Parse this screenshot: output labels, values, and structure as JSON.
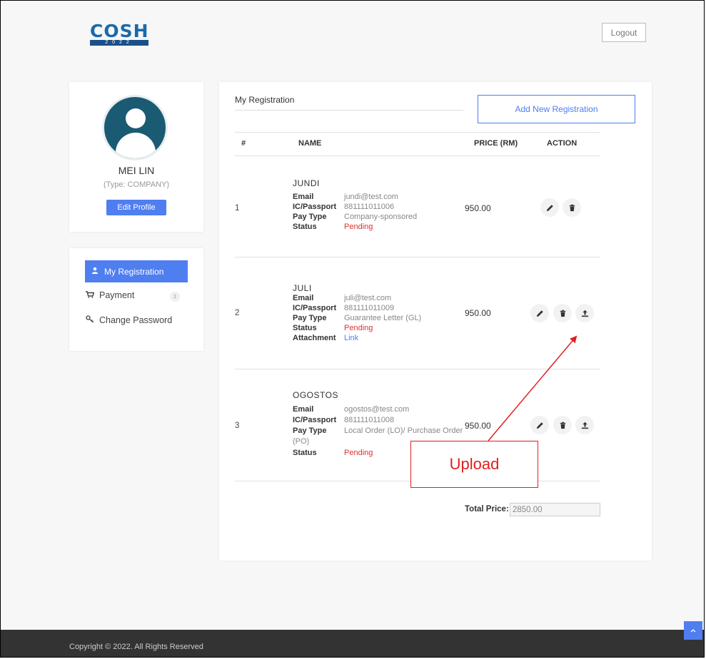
{
  "header": {
    "logo_text": "COSH",
    "logo_sub": "2022",
    "logout_label": "Logout"
  },
  "profile": {
    "name": "MEI LIN",
    "type": "(Type: COMPANY)",
    "edit_label": "Edit Profile"
  },
  "menu": {
    "items": [
      {
        "label": "My Registration",
        "icon": "user-icon"
      },
      {
        "label": "Payment",
        "icon": "cart-icon",
        "badge": "1"
      },
      {
        "label": "Change Password",
        "icon": "key-icon"
      }
    ]
  },
  "main": {
    "title": "My Registration",
    "add_label": "Add New Registration",
    "headers": {
      "num": "#",
      "name": "NAME",
      "price": "PRICE (RM)",
      "action": "ACTION"
    },
    "field_labels": {
      "email": "Email",
      "ic": "IC/Passport",
      "pay_type": "Pay Type",
      "status": "Status",
      "attachment": "Attachment"
    },
    "rows": [
      {
        "num": "1",
        "name": "JUNDI",
        "email": "jundi@test.com",
        "ic": "881111011006",
        "pay_type": "Company-sponsored",
        "status": "Pending",
        "price": "950.00"
      },
      {
        "num": "2",
        "name": "JULI",
        "email": "juli@test.com",
        "ic": "881111011009",
        "pay_type": "Guarantee Letter (GL)",
        "status": "Pending",
        "attachment": "Link",
        "price": "950.00"
      },
      {
        "num": "3",
        "name": "OGOSTOS",
        "email": "ogostos@test.com",
        "ic": "881111011008",
        "pay_type_line1": "Local Order (LO)/ Purchase Order",
        "pay_type_line2": "(PO)",
        "status": "Pending",
        "price": "950.00"
      }
    ],
    "total_label": "Total Price:",
    "total_value": "2850.00"
  },
  "annotation": {
    "label": "Upload",
    "color": "#e02020"
  },
  "footer": {
    "copyright": "Copyright © 2022. All Rights Reserved"
  },
  "colors": {
    "accent": "#4f7ef0",
    "pending": "#e03030"
  }
}
